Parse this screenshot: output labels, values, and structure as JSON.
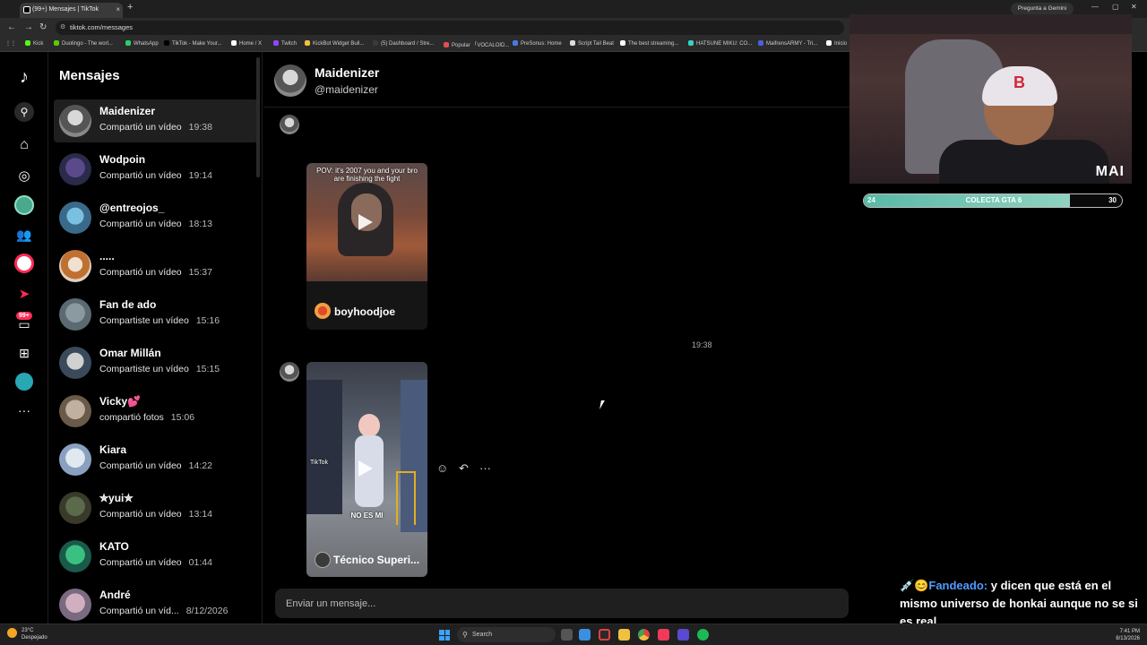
{
  "browser": {
    "tab_title": "(99+) Mensajes | TikTok",
    "tab_close": "×",
    "new_tab": "+",
    "gemini": "Pregunta a Gemini",
    "url": "tiktok.com/messages",
    "minimize": "—",
    "maximize": "▢",
    "close": "✕",
    "bookmarks": [
      "Kick",
      "Duolingo - The worl...",
      "WhatsApp",
      "TikTok - Make Your...",
      "Home / X",
      "Twitch",
      "KickBot Widget Buil...",
      "(5) Dashboard / Stre...",
      "Popular 「VOCALOID...",
      "PreSonus: Home",
      "Script Tail Beat",
      "The best streaming...",
      "HATSUNE MIKU: CO...",
      "MaifrensARMY - Tri...",
      "Inicio"
    ]
  },
  "rail": {
    "badge": "99+"
  },
  "sidebar": {
    "title": "Mensajes",
    "conversations": [
      {
        "name": "Maidenizer",
        "preview": "Compartió un vídeo",
        "time": "19:38"
      },
      {
        "name": "Wodpoin",
        "preview": "Compartió un vídeo",
        "time": "19:14"
      },
      {
        "name": "@entreojos_",
        "preview": "Compartió un vídeo",
        "time": "18:13"
      },
      {
        "name": ".....",
        "preview": "Compartió un vídeo",
        "time": "15:37"
      },
      {
        "name": "Fan de ado",
        "preview": "Compartiste un vídeo",
        "time": "15:16"
      },
      {
        "name": "Omar Millán",
        "preview": "Compartiste un vídeo",
        "time": "15:15"
      },
      {
        "name": "Vicky💕",
        "preview": "compartió fotos",
        "time": "15:06"
      },
      {
        "name": "Kiara",
        "preview": "Compartió un vídeo",
        "time": "14:22"
      },
      {
        "name": "✮yui✮",
        "preview": "Compartió un vídeo",
        "time": "13:14"
      },
      {
        "name": "KATO",
        "preview": "Compartió un vídeo",
        "time": "01:44"
      },
      {
        "name": "André",
        "preview": "Compartió un víd...",
        "time": "8/12/2026"
      }
    ]
  },
  "chat": {
    "name": "Maidenizer",
    "handle": "@maidenizer",
    "timestamp": "19:38",
    "video1": {
      "caption": "POV: it's 2007 you and your bro are finishing the fight",
      "author": "boyhoodjoe"
    },
    "video2": {
      "caption": "NO ES MI",
      "watermark": "TikTok",
      "author": "Técnico Superi..."
    },
    "actions": {
      "react": "☺",
      "reply": "↶",
      "more": "···"
    },
    "input_placeholder": "Enviar un mensaje..."
  },
  "overlay": {
    "webcam_logo": "MAI",
    "cap_letter": "B",
    "goal": {
      "start": "24",
      "label": "COLECTA GTA 6",
      "end": "30",
      "current": 24,
      "target": 30
    },
    "chat_icons": "💉😊",
    "chat_user": "Fandeado:",
    "chat_message": " y dicen que está en el mismo universo de honkai aunque no se si es real"
  },
  "taskbar": {
    "temp": "23°C",
    "weather": "Despejado",
    "search": "Search",
    "time": "7:41 PM",
    "date": "8/13/2026"
  },
  "colors": {
    "accent": "#fe2c55",
    "goal_fill": "#59b9a6",
    "chat_user": "#4f9bff"
  }
}
